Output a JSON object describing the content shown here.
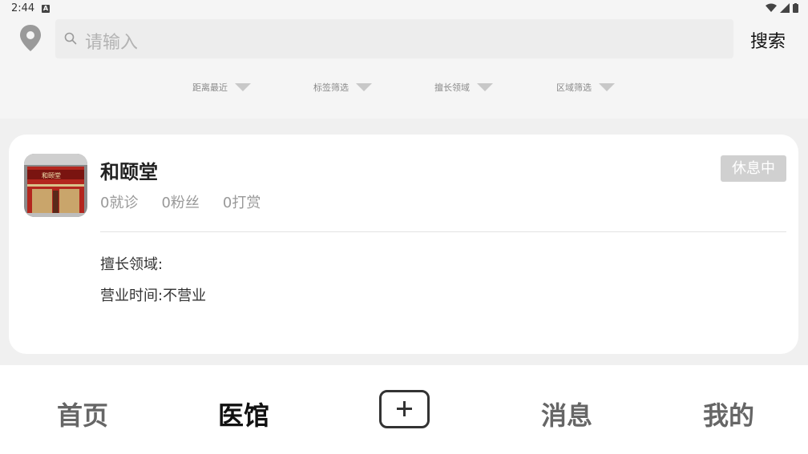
{
  "status_bar": {
    "time": "2:44",
    "notification_letter": "A"
  },
  "header": {
    "location_icon": "map-pin-icon",
    "search_placeholder": "请输入",
    "search_button": "搜索"
  },
  "filters": [
    {
      "label": "距离最近"
    },
    {
      "label": "标签筛选"
    },
    {
      "label": "擅长领域"
    },
    {
      "label": "区域筛选"
    }
  ],
  "clinic": {
    "name": "和颐堂",
    "visits": "0就诊",
    "fans": "0粉丝",
    "tips": "0打赏",
    "status": "休息中",
    "specialty_label": "擅长领域:",
    "hours_label": "营业时间:",
    "hours_value": "不营业",
    "sign_text": "和颐堂"
  },
  "tabbar": {
    "home": "首页",
    "clinics": "医馆",
    "add_icon": "plus-icon",
    "messages": "消息",
    "mine": "我的"
  }
}
